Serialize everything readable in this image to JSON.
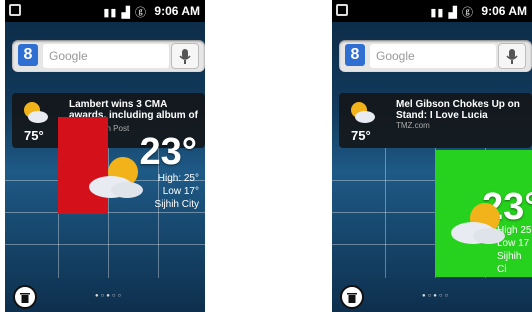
{
  "screens": [
    {
      "status": {
        "time": "9:06 AM"
      },
      "search": {
        "placeholder": "Google",
        "logo": "8"
      },
      "news": {
        "headline": "Lambert wins 3 CMA awards, including album of year",
        "source": "Washington Post",
        "temp": "75°"
      },
      "widget": {
        "temp": "23°",
        "high_label": "High: 25°",
        "low_label": "Low 17°",
        "city": "Sijhih City",
        "bg_color": "#d4111a"
      }
    },
    {
      "status": {
        "time": "9:06 AM"
      },
      "search": {
        "placeholder": "Google",
        "logo": "8"
      },
      "news": {
        "headline": "Mel Gibson Chokes Up on Stand: I Love Lucia",
        "source": "TMZ.com",
        "temp": "75°"
      },
      "widget": {
        "temp": "23°",
        "high_label": "High 25",
        "low_label": "Low 17",
        "city": "Sijhih Ci",
        "bg_color": "#26d21d"
      }
    }
  ],
  "dots": "●○●○○",
  "accent": "#2f6fd1"
}
